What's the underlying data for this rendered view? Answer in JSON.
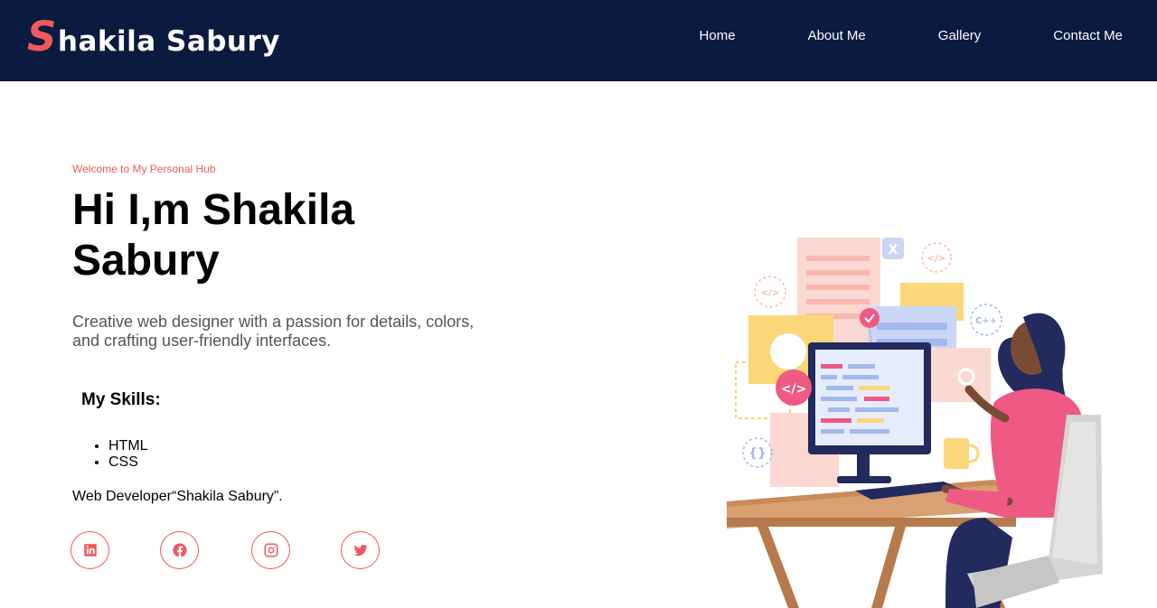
{
  "brand": {
    "first_letter": "S",
    "rest": "hakila Sabury"
  },
  "nav": {
    "items": [
      "Home",
      "About Me",
      "Gallery",
      "Contact Me"
    ]
  },
  "hero": {
    "welcome": "Welcome to My Personal Hub",
    "title": "Hi I,m Shakila Sabury",
    "description": "Creative web designer with a passion for details, colors, and crafting user-friendly interfaces."
  },
  "skills": {
    "heading": "My Skills:",
    "items": [
      "HTML",
      "CSS"
    ]
  },
  "role": "Web Developer“Shakila Sabury”.",
  "social": {
    "icons": [
      "linkedin-icon",
      "facebook-icon",
      "instagram-icon",
      "twitter-icon"
    ]
  },
  "colors": {
    "navbar": "#0b1a3f",
    "accent": "#f05a5a",
    "text": "#000000",
    "muted": "#555555"
  },
  "illustration": {
    "screen_code": "</>",
    "sticker_text": "C++",
    "pin_text": "X"
  }
}
